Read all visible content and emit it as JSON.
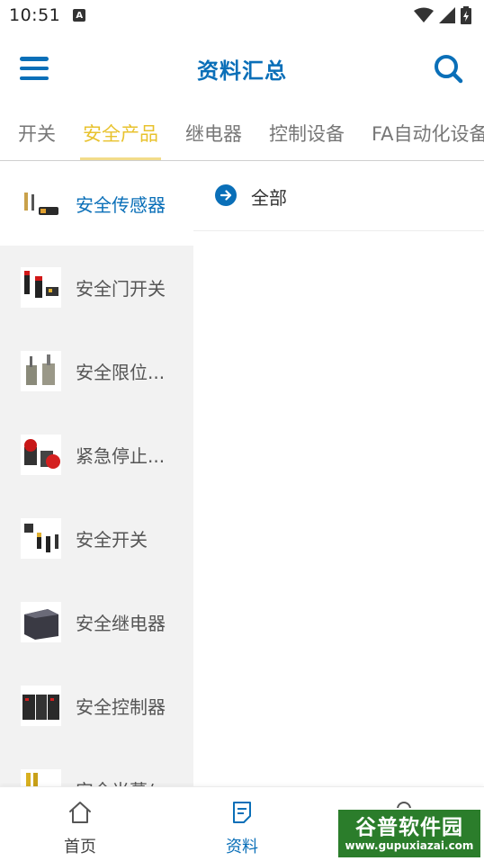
{
  "status": {
    "time": "10:51",
    "notification_glyph": "A",
    "icons": [
      "wifi-icon",
      "signal-icon",
      "battery-icon"
    ]
  },
  "header": {
    "title": "资料汇总",
    "menu_icon": "hamburger-menu-icon",
    "search_icon": "search-icon"
  },
  "tabs": [
    {
      "label": "开关",
      "active": false
    },
    {
      "label": "安全产品",
      "active": true
    },
    {
      "label": "继电器",
      "active": false
    },
    {
      "label": "控制设备",
      "active": false
    },
    {
      "label": "FA自动化设备",
      "active": false
    }
  ],
  "categories": [
    {
      "label": "安全传感器",
      "active": true
    },
    {
      "label": "安全门开关",
      "active": false
    },
    {
      "label": "安全限位...",
      "active": false
    },
    {
      "label": "紧急停止...",
      "active": false
    },
    {
      "label": "安全开关",
      "active": false
    },
    {
      "label": "安全继电器",
      "active": false
    },
    {
      "label": "安全控制器",
      "active": false
    },
    {
      "label": "安全光幕/...",
      "active": false
    }
  ],
  "content": {
    "all_label": "全部",
    "all_icon": "arrow-right-circle-icon"
  },
  "bottom_nav": [
    {
      "label": "首页",
      "icon": "home-icon",
      "active": false
    },
    {
      "label": "资料",
      "icon": "document-icon",
      "active": true
    },
    {
      "label": "",
      "icon": "user-icon",
      "active": false
    }
  ],
  "watermark": {
    "title": "谷普软件园",
    "url": "www.gupuxiazai.com"
  },
  "colors": {
    "primary": "#0a6fb8",
    "tab_active": "#e8c22d",
    "sidebar_bg": "#f2f2f2"
  }
}
